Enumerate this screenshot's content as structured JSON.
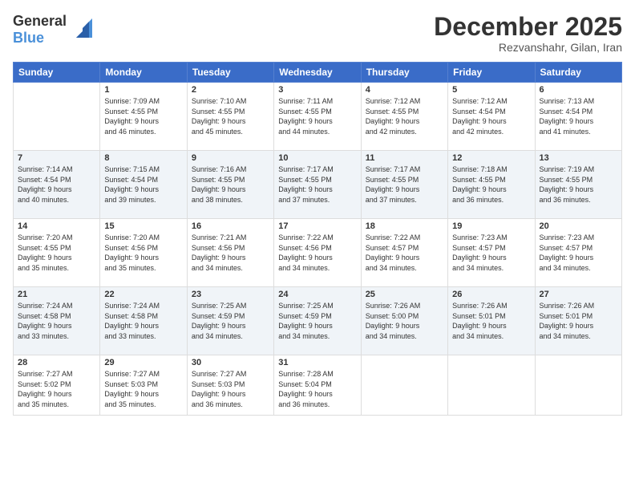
{
  "header": {
    "logo_general": "General",
    "logo_blue": "Blue",
    "month": "December 2025",
    "location": "Rezvanshahr, Gilan, Iran"
  },
  "days_of_week": [
    "Sunday",
    "Monday",
    "Tuesday",
    "Wednesday",
    "Thursday",
    "Friday",
    "Saturday"
  ],
  "weeks": [
    [
      {
        "day": "",
        "info": ""
      },
      {
        "day": "1",
        "info": "Sunrise: 7:09 AM\nSunset: 4:55 PM\nDaylight: 9 hours\nand 46 minutes."
      },
      {
        "day": "2",
        "info": "Sunrise: 7:10 AM\nSunset: 4:55 PM\nDaylight: 9 hours\nand 45 minutes."
      },
      {
        "day": "3",
        "info": "Sunrise: 7:11 AM\nSunset: 4:55 PM\nDaylight: 9 hours\nand 44 minutes."
      },
      {
        "day": "4",
        "info": "Sunrise: 7:12 AM\nSunset: 4:55 PM\nDaylight: 9 hours\nand 42 minutes."
      },
      {
        "day": "5",
        "info": "Sunrise: 7:12 AM\nSunset: 4:54 PM\nDaylight: 9 hours\nand 42 minutes."
      },
      {
        "day": "6",
        "info": "Sunrise: 7:13 AM\nSunset: 4:54 PM\nDaylight: 9 hours\nand 41 minutes."
      }
    ],
    [
      {
        "day": "7",
        "info": "Sunrise: 7:14 AM\nSunset: 4:54 PM\nDaylight: 9 hours\nand 40 minutes."
      },
      {
        "day": "8",
        "info": "Sunrise: 7:15 AM\nSunset: 4:54 PM\nDaylight: 9 hours\nand 39 minutes."
      },
      {
        "day": "9",
        "info": "Sunrise: 7:16 AM\nSunset: 4:55 PM\nDaylight: 9 hours\nand 38 minutes."
      },
      {
        "day": "10",
        "info": "Sunrise: 7:17 AM\nSunset: 4:55 PM\nDaylight: 9 hours\nand 37 minutes."
      },
      {
        "day": "11",
        "info": "Sunrise: 7:17 AM\nSunset: 4:55 PM\nDaylight: 9 hours\nand 37 minutes."
      },
      {
        "day": "12",
        "info": "Sunrise: 7:18 AM\nSunset: 4:55 PM\nDaylight: 9 hours\nand 36 minutes."
      },
      {
        "day": "13",
        "info": "Sunrise: 7:19 AM\nSunset: 4:55 PM\nDaylight: 9 hours\nand 36 minutes."
      }
    ],
    [
      {
        "day": "14",
        "info": "Sunrise: 7:20 AM\nSunset: 4:55 PM\nDaylight: 9 hours\nand 35 minutes."
      },
      {
        "day": "15",
        "info": "Sunrise: 7:20 AM\nSunset: 4:56 PM\nDaylight: 9 hours\nand 35 minutes."
      },
      {
        "day": "16",
        "info": "Sunrise: 7:21 AM\nSunset: 4:56 PM\nDaylight: 9 hours\nand 34 minutes."
      },
      {
        "day": "17",
        "info": "Sunrise: 7:22 AM\nSunset: 4:56 PM\nDaylight: 9 hours\nand 34 minutes."
      },
      {
        "day": "18",
        "info": "Sunrise: 7:22 AM\nSunset: 4:57 PM\nDaylight: 9 hours\nand 34 minutes."
      },
      {
        "day": "19",
        "info": "Sunrise: 7:23 AM\nSunset: 4:57 PM\nDaylight: 9 hours\nand 34 minutes."
      },
      {
        "day": "20",
        "info": "Sunrise: 7:23 AM\nSunset: 4:57 PM\nDaylight: 9 hours\nand 34 minutes."
      }
    ],
    [
      {
        "day": "21",
        "info": "Sunrise: 7:24 AM\nSunset: 4:58 PM\nDaylight: 9 hours\nand 33 minutes."
      },
      {
        "day": "22",
        "info": "Sunrise: 7:24 AM\nSunset: 4:58 PM\nDaylight: 9 hours\nand 33 minutes."
      },
      {
        "day": "23",
        "info": "Sunrise: 7:25 AM\nSunset: 4:59 PM\nDaylight: 9 hours\nand 34 minutes."
      },
      {
        "day": "24",
        "info": "Sunrise: 7:25 AM\nSunset: 4:59 PM\nDaylight: 9 hours\nand 34 minutes."
      },
      {
        "day": "25",
        "info": "Sunrise: 7:26 AM\nSunset: 5:00 PM\nDaylight: 9 hours\nand 34 minutes."
      },
      {
        "day": "26",
        "info": "Sunrise: 7:26 AM\nSunset: 5:01 PM\nDaylight: 9 hours\nand 34 minutes."
      },
      {
        "day": "27",
        "info": "Sunrise: 7:26 AM\nSunset: 5:01 PM\nDaylight: 9 hours\nand 34 minutes."
      }
    ],
    [
      {
        "day": "28",
        "info": "Sunrise: 7:27 AM\nSunset: 5:02 PM\nDaylight: 9 hours\nand 35 minutes."
      },
      {
        "day": "29",
        "info": "Sunrise: 7:27 AM\nSunset: 5:03 PM\nDaylight: 9 hours\nand 35 minutes."
      },
      {
        "day": "30",
        "info": "Sunrise: 7:27 AM\nSunset: 5:03 PM\nDaylight: 9 hours\nand 36 minutes."
      },
      {
        "day": "31",
        "info": "Sunrise: 7:28 AM\nSunset: 5:04 PM\nDaylight: 9 hours\nand 36 minutes."
      },
      {
        "day": "",
        "info": ""
      },
      {
        "day": "",
        "info": ""
      },
      {
        "day": "",
        "info": ""
      }
    ]
  ]
}
